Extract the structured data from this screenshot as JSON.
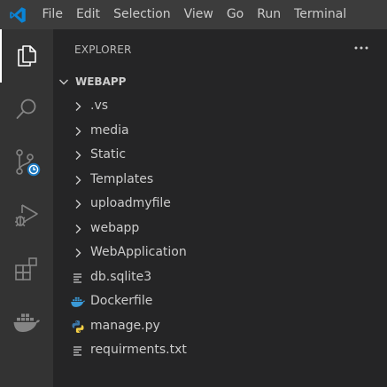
{
  "titlebar": {
    "logo_icon": "vscode-logo-icon",
    "menu": [
      "File",
      "Edit",
      "Selection",
      "View",
      "Go",
      "Run",
      "Terminal"
    ]
  },
  "activity_bar": {
    "items": [
      {
        "name": "explorer",
        "icon": "files-icon",
        "active": true
      },
      {
        "name": "search",
        "icon": "search-icon",
        "active": false
      },
      {
        "name": "source-control",
        "icon": "source-control-icon",
        "active": false
      },
      {
        "name": "run-debug",
        "icon": "run-debug-icon",
        "active": false
      },
      {
        "name": "extensions",
        "icon": "extensions-icon",
        "active": false
      },
      {
        "name": "docker",
        "icon": "docker-icon",
        "active": false
      }
    ]
  },
  "explorer": {
    "title": "EXPLORER",
    "more_actions_icon": "ellipsis-icon",
    "root_folder": "WEBAPP",
    "items": [
      {
        "label": ".vs",
        "type": "folder"
      },
      {
        "label": "media",
        "type": "folder"
      },
      {
        "label": "Static",
        "type": "folder"
      },
      {
        "label": "Templates",
        "type": "folder"
      },
      {
        "label": "uploadmyfile",
        "type": "folder"
      },
      {
        "label": "webapp",
        "type": "folder"
      },
      {
        "label": "WebApplication",
        "type": "folder"
      },
      {
        "label": "db.sqlite3",
        "type": "file-text"
      },
      {
        "label": "Dockerfile",
        "type": "file-docker"
      },
      {
        "label": "manage.py",
        "type": "file-python"
      },
      {
        "label": "requirments.txt",
        "type": "file-text"
      }
    ]
  },
  "colors": {
    "titlebar_bg": "#3c3c3c",
    "activitybar_bg": "#333333",
    "sidebar_bg": "#252526",
    "text": "#cccccc",
    "vscode_blue": "#0a84d6",
    "badge_blue": "#1c79c0",
    "docker_blue": "#3a9ad8",
    "python_blue": "#3c78aa",
    "python_yellow": "#f5cf46"
  }
}
